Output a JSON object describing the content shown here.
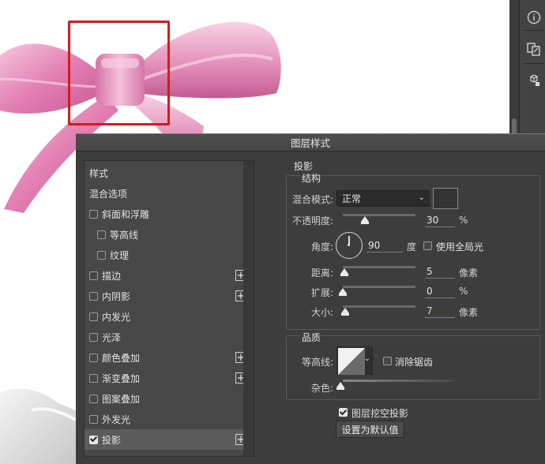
{
  "dialog": {
    "title": "图层样式"
  },
  "style_list": [
    {
      "label": "样式",
      "checkbox": false,
      "plus": false
    },
    {
      "label": "混合选项",
      "checkbox": false,
      "plus": false
    },
    {
      "label": "斜面和浮雕",
      "checkbox": true,
      "checked": false,
      "plus": false
    },
    {
      "label": "等高线",
      "checkbox": true,
      "checked": false,
      "plus": false,
      "indent": true
    },
    {
      "label": "纹理",
      "checkbox": true,
      "checked": false,
      "plus": false,
      "indent": true
    },
    {
      "label": "描边",
      "checkbox": true,
      "checked": false,
      "plus": true
    },
    {
      "label": "内阴影",
      "checkbox": true,
      "checked": false,
      "plus": true
    },
    {
      "label": "内发光",
      "checkbox": true,
      "checked": false,
      "plus": false
    },
    {
      "label": "光泽",
      "checkbox": true,
      "checked": false,
      "plus": false
    },
    {
      "label": "颜色叠加",
      "checkbox": true,
      "checked": false,
      "plus": true
    },
    {
      "label": "渐变叠加",
      "checkbox": true,
      "checked": false,
      "plus": true
    },
    {
      "label": "图案叠加",
      "checkbox": true,
      "checked": false,
      "plus": false
    },
    {
      "label": "外发光",
      "checkbox": true,
      "checked": false,
      "plus": false
    },
    {
      "label": "投影",
      "checkbox": true,
      "checked": true,
      "plus": true,
      "selected": true
    }
  ],
  "drop_shadow": {
    "section_title": "投影",
    "structure_title": "结构",
    "blend_mode_label": "混合模式:",
    "blend_mode_value": "正常",
    "opacity_label": "不透明度:",
    "opacity_value": "30",
    "opacity_unit": "%",
    "opacity_level": 0.3,
    "angle_label": "角度:",
    "angle_value": "90",
    "angle_unit": "度",
    "global_light_label": "使用全局光",
    "global_light_checked": false,
    "distance_label": "距离:",
    "distance_value": "5",
    "distance_unit": "像素",
    "spread_label": "扩展:",
    "spread_value": "0",
    "spread_unit": "%",
    "size_label": "大小:",
    "size_value": "7",
    "size_unit": "像素",
    "quality_title": "品质",
    "contour_label": "等高线:",
    "anti_alias_label": "消除锯齿",
    "anti_alias_checked": false,
    "noise_label": "杂色:",
    "knockout_label": "图层挖空投影",
    "knockout_checked": true,
    "default_button": "设置为默认值"
  },
  "colors": {
    "selection_box": "#d8191b",
    "ribbon_pink": "#e48cb8",
    "dialog_bg": "#3d3d3d"
  },
  "right_panel_icons": [
    "info-icon",
    "layer-comps-icon",
    "3d-cube-icon"
  ]
}
